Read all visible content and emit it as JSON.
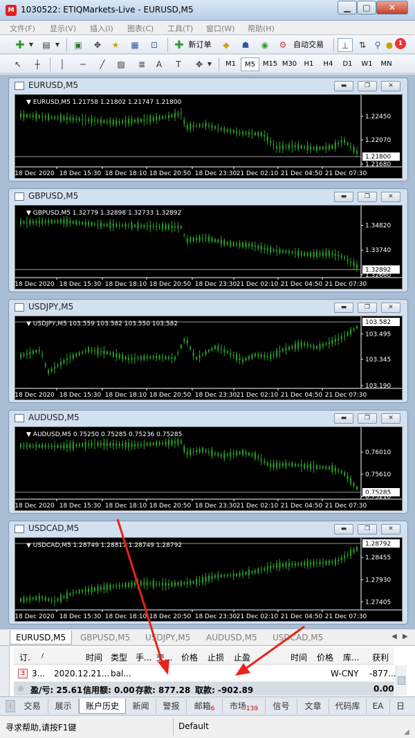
{
  "window": {
    "title": "1030522: ETIQMarkets-Live - EURUSD,M5",
    "app_icon": "metatrader-icon",
    "min": "▁",
    "max": "□",
    "close": "✕"
  },
  "menu": [
    "文件(F)",
    "显示(V)",
    "插入(I)",
    "图表(C)",
    "工具(T)",
    "窗口(W)",
    "帮助(H)"
  ],
  "toolbar": {
    "new_order": "新订单",
    "auto_trading": "自动交易",
    "notifications_count": "1",
    "timeframes": [
      "M1",
      "M5",
      "M15",
      "M30",
      "H1",
      "H4",
      "D1",
      "W1",
      "MN"
    ],
    "active_timeframe": "M5"
  },
  "charts": [
    {
      "window_title": "EURUSD,M5",
      "info": "EURUSD,M5  1.21758 1.21802 1.21747 1.21800",
      "price_labels": [
        "1.22450",
        "1.22070",
        "1.21800",
        "1.21680"
      ],
      "current_price": "1.21800",
      "time_labels": [
        "18 Dec 2020",
        "18 Dec 15:30",
        "18 Dec 18:10",
        "18 Dec 20:50",
        "18 Dec 23:30",
        "21 Dec 02:10",
        "21 Dec 04:50",
        "21 Dec 07:30"
      ],
      "ylim": [
        1.2168,
        1.2275
      ]
    },
    {
      "window_title": "GBPUSD,M5",
      "info": "GBPUSD,M5  1.32779 1.32898 1.32733 1.32892",
      "price_labels": [
        "1.34820",
        "1.33740",
        "1.32892",
        "1.32660"
      ],
      "current_price": "1.32892",
      "time_labels": [
        "18 Dec 2020",
        "18 Dec 15:30",
        "18 Dec 18:10",
        "18 Dec 20:50",
        "18 Dec 23:30",
        "21 Dec 02:10",
        "21 Dec 04:50",
        "21 Dec 07:30"
      ],
      "ylim": [
        1.3266,
        1.3556
      ]
    },
    {
      "window_title": "USDJPY,M5",
      "info": "USDJPY,M5  103.559 103.582 103.550 103.582",
      "price_labels": [
        "103.582",
        "103.495",
        "103.345",
        "103.190"
      ],
      "current_price": "103.582",
      "time_labels": [
        "18 Dec 2020",
        "18 Dec 15:30",
        "18 Dec 18:10",
        "18 Dec 20:50",
        "18 Dec 23:30",
        "21 Dec 02:10",
        "21 Dec 04:50",
        "21 Dec 07:30"
      ],
      "ylim": [
        103.19,
        103.582
      ]
    },
    {
      "window_title": "AUDUSD,M5",
      "info": "AUDUSD,M5  0.75250 0.75285 0.75236 0.75285",
      "price_labels": [
        "0.76010",
        "0.75610",
        "0.75285",
        "0.75210"
      ],
      "current_price": "0.75285",
      "time_labels": [
        "18 Dec 2020",
        "18 Dec 15:30",
        "18 Dec 18:10",
        "18 Dec 20:50",
        "18 Dec 23:30",
        "21 Dec 02:10",
        "21 Dec 04:50",
        "21 Dec 07:30"
      ],
      "ylim": [
        0.7521,
        0.7641
      ]
    },
    {
      "window_title": "USDCAD,M5",
      "info": "USDCAD,M5  1.28749 1.28817 1.28749 1.28792",
      "price_labels": [
        "1.28792",
        "1.28455",
        "1.27930",
        "1.27405"
      ],
      "current_price": "1.28792",
      "time_labels": [
        "18 Dec 2020",
        "18 Dec 15:30",
        "18 Dec 18:10",
        "18 Dec 20:50",
        "18 Dec 23:30",
        "21 Dec 02:10",
        "21 Dec 04:50",
        "21 Dec 07:30"
      ],
      "ylim": [
        1.2728,
        1.2885
      ]
    }
  ],
  "symbol_tabs": [
    "EURUSD,M5",
    "GBPUSD,M5",
    "USDJPY,M5",
    "AUDUSD,M5",
    "USDCAD,M5"
  ],
  "symbol_tabs_arrows": [
    "◀",
    "▶"
  ],
  "terminal": {
    "headers": [
      "订.",
      "/",
      "时间",
      "类型",
      "手...",
      "交...",
      "价格",
      "止损",
      "止盈",
      "时间",
      "价格",
      "库...",
      "获利"
    ],
    "row": {
      "icon_label": "3",
      "order": "3...",
      "time": "2020.12.21...",
      "type": "bal...",
      "comment": "W-CNY",
      "profit": "-877..."
    },
    "summary": {
      "profit_loss": "盈/亏: 25.61",
      "credit": "信用额: 0.00",
      "deposit": "存款: 877.28",
      "withdrawal": "取款: -902.89",
      "total": "0.00"
    }
  },
  "bottom_tabs": [
    {
      "label": "交易",
      "count": ""
    },
    {
      "label": "展示",
      "count": ""
    },
    {
      "label": "账户历史",
      "count": ""
    },
    {
      "label": "新闻",
      "count": ""
    },
    {
      "label": "警报",
      "count": ""
    },
    {
      "label": "邮箱",
      "count": "6"
    },
    {
      "label": "市场",
      "count": "139"
    },
    {
      "label": "信号",
      "count": ""
    },
    {
      "label": "文章",
      "count": ""
    },
    {
      "label": "代码库",
      "count": ""
    },
    {
      "label": "EA",
      "count": ""
    },
    {
      "label": "日",
      "count": ""
    }
  ],
  "active_bottom_tab": "账户历史",
  "status": {
    "help": "寻求帮助,请按F1键",
    "profile": "Default"
  },
  "colors": {
    "chart_bg": "#000000",
    "candle": "#2aa52a",
    "annotation_arrow": "#e8231b"
  }
}
